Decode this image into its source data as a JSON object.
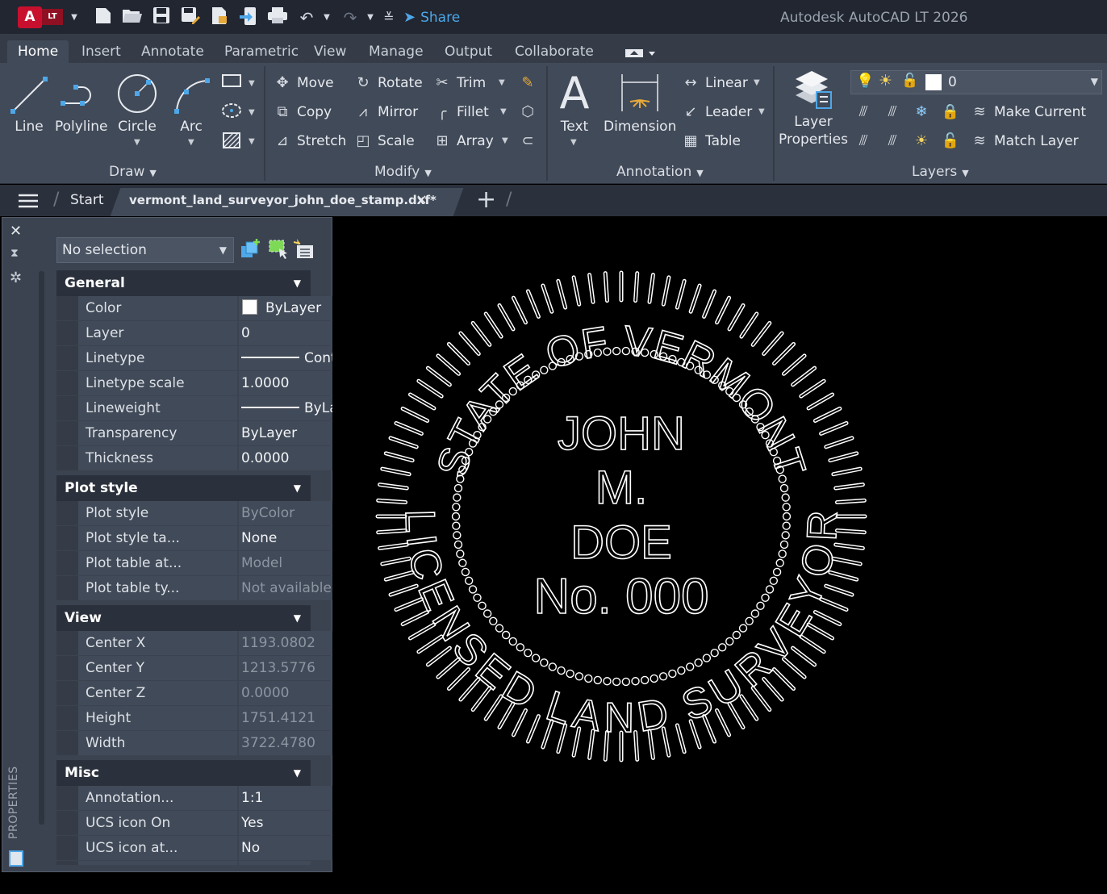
{
  "app": {
    "title": "Autodesk AutoCAD LT 2026",
    "logo_letter": "A",
    "logo_badge": "LT",
    "share_label": "Share"
  },
  "quick_access": [
    "new-icon",
    "open-icon",
    "save-icon",
    "save-as-icon",
    "export-icon",
    "import-icon",
    "plot-icon",
    "undo-icon",
    "redo-icon",
    "customize-icon"
  ],
  "ribbon_tabs": [
    "Home",
    "Insert",
    "Annotate",
    "Parametric",
    "View",
    "Manage",
    "Output",
    "Collaborate"
  ],
  "active_tab": "Home",
  "panels": {
    "draw": {
      "title": "Draw",
      "tools": [
        "Line",
        "Polyline",
        "Circle",
        "Arc"
      ]
    },
    "modify": {
      "title": "Modify",
      "col1": [
        "Move",
        "Copy",
        "Stretch"
      ],
      "col2": [
        "Rotate",
        "Mirror",
        "Scale"
      ],
      "col3": [
        "Trim",
        "Fillet",
        "Array"
      ]
    },
    "annotation": {
      "title": "Annotation",
      "text": "Text",
      "dimension": "Dimension",
      "linear": "Linear",
      "leader": "Leader",
      "table": "Table"
    },
    "layers": {
      "title": "Layers",
      "layer_properties_line1": "Layer",
      "layer_properties_line2": "Properties",
      "current_layer": "0",
      "make_current": "Make Current",
      "match_layer": "Match Layer"
    }
  },
  "doc_tabs": {
    "start": "Start",
    "active_file": "vermont_land_surveyor_john_doe_stamp.dxf*",
    "close_glyph": "×",
    "add_glyph": "+"
  },
  "properties": {
    "palette_label": "PROPERTIES",
    "selection": "No selection",
    "sections": {
      "general": {
        "title": "General",
        "rows": [
          {
            "name": "Color",
            "value": "ByLayer"
          },
          {
            "name": "Layer",
            "value": "0"
          },
          {
            "name": "Linetype",
            "value": "Contin..."
          },
          {
            "name": "Linetype scale",
            "value": "1.0000"
          },
          {
            "name": "Lineweight",
            "value": "ByLayer"
          },
          {
            "name": "Transparency",
            "value": "ByLayer"
          },
          {
            "name": "Thickness",
            "value": "0.0000"
          }
        ]
      },
      "plot_style": {
        "title": "Plot style",
        "rows": [
          {
            "name": "Plot style",
            "value": "ByColor"
          },
          {
            "name": "Plot style ta...",
            "value": "None"
          },
          {
            "name": "Plot table at...",
            "value": "Model"
          },
          {
            "name": "Plot table ty...",
            "value": "Not available"
          }
        ]
      },
      "view": {
        "title": "View",
        "rows": [
          {
            "name": "Center X",
            "value": "1193.0802"
          },
          {
            "name": "Center Y",
            "value": "1213.5776"
          },
          {
            "name": "Center Z",
            "value": "0.0000"
          },
          {
            "name": "Height",
            "value": "1751.4121"
          },
          {
            "name": "Width",
            "value": "3722.4780"
          }
        ]
      },
      "misc": {
        "title": "Misc",
        "rows": [
          {
            "name": "Annotation...",
            "value": "1:1"
          },
          {
            "name": "UCS icon On",
            "value": "Yes"
          },
          {
            "name": "UCS icon at...",
            "value": "No"
          }
        ]
      }
    }
  },
  "drawing": {
    "top_arc_text": "STATE OF VERMONT",
    "bottom_arc_text": "LICENSED LAND SURVEYOR",
    "line1": "JOHN",
    "line2": "M.",
    "line3": "DOE",
    "line4": "No. 000",
    "stroke_color": "#ffffff",
    "background_color": "#000000"
  },
  "colors": {
    "titlebar": "#212631",
    "ribbon": "#414a58",
    "share": "#4ea7e8",
    "logo": "#c8102e"
  }
}
